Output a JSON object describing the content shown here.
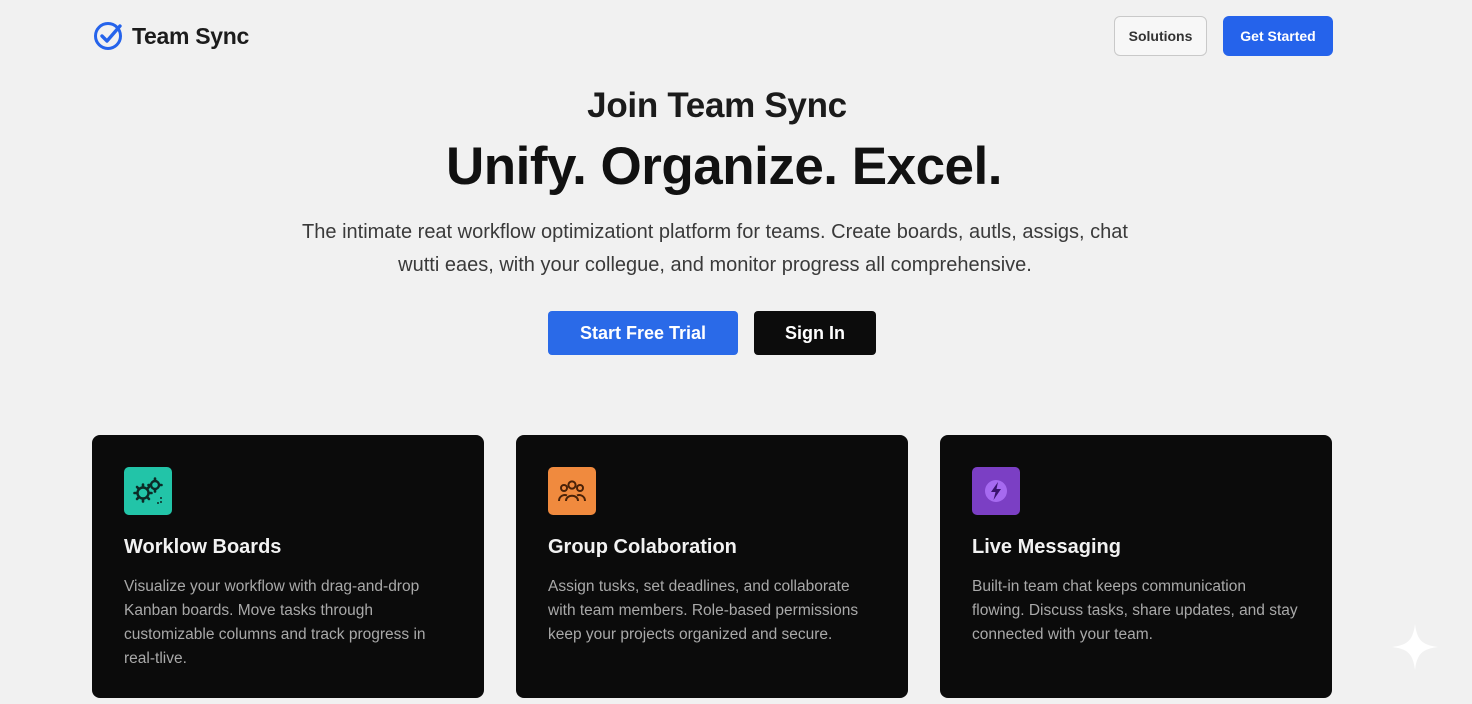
{
  "header": {
    "brand": "Team Sync",
    "nav": {
      "solutions_label": "Solutions",
      "get_started_label": "Get Started"
    }
  },
  "hero": {
    "kicker": "Join Team Sync",
    "title": "Unify. Organize. Excel.",
    "description_line1": "The intimate reat workflow optimizationt platform for teams. Create boards, autls, assigs, chat",
    "description_line2": "wutti eaes, with your collegue, and monitor progress all comprehensive.",
    "trial_label": "Start Free Trial",
    "signin_label": "Sign In"
  },
  "features": [
    {
      "icon": "gears-icon",
      "icon_color": "#22c4a8",
      "title": "Worklow Boards",
      "text": "Visualize your workflow with drag-and-drop Kanban boards. Move tasks through customizable columns and track progress in real-tlive."
    },
    {
      "icon": "team-icon",
      "icon_color": "#f08a3e",
      "title": "Group Colaboration",
      "text": "Assign tusks, set deadlines, and collaborate with team members. Role-based permissions keep your projects organized and secure."
    },
    {
      "icon": "lightning-icon",
      "icon_color": "#7b3fc4",
      "title": "Live Messaging",
      "text": "Built-in team chat keeps communication flowing. Discuss tasks, share updates, and stay connected with your team."
    }
  ],
  "colors": {
    "primary": "#2563eb",
    "background": "#f1f1f1",
    "card": "#0b0b0b"
  }
}
